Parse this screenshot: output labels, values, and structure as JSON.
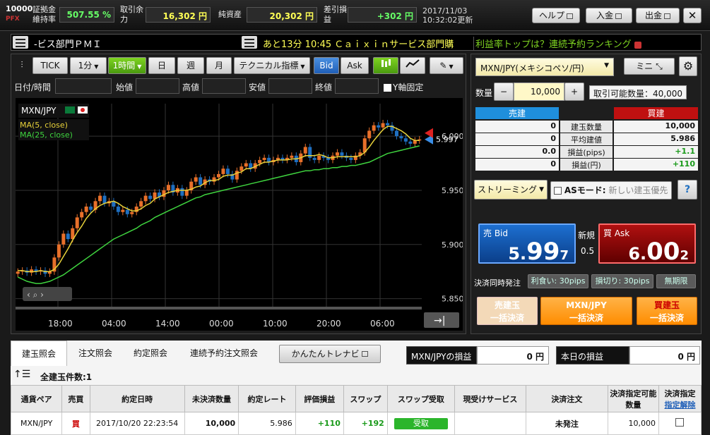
{
  "app": {
    "logo_top": "10000",
    "logo_bottom": "PFX"
  },
  "account": {
    "margin_label": "証拠金維持率",
    "margin_value": "507.55 %",
    "available_label": "取引余力",
    "available_value": "16,302 円",
    "assets_label": "純資産",
    "assets_value": "20,302 円",
    "pl_label": "差引損益",
    "pl_value": "+302 円",
    "date": "2017/11/03",
    "time": "10:32:02更新"
  },
  "top_buttons": {
    "help": "ヘルプ",
    "deposit": "入金",
    "withdraw": "出金",
    "close": "✕"
  },
  "news": {
    "left": "-ビス部門ＰＭＩ",
    "middle": "あと13分 10:45 Ｃａｉｘｉｎサービス部門購",
    "right": "利益率トップは？連続予約ランキング"
  },
  "chart_toolbar": {
    "tick": "TICK",
    "min": "1分",
    "hour": "1時間",
    "day": "日",
    "week": "週",
    "month": "月",
    "indicators": "テクニカル指標",
    "bid": "Bid",
    "ask": "Ask"
  },
  "ohlc": {
    "datetime": "日付/時間",
    "open": "始値",
    "high": "高値",
    "low": "安値",
    "close": "終値",
    "fix_y": "Y軸固定"
  },
  "chart_data": {
    "type": "candlestick",
    "symbol": "MXN/JPY",
    "legend": [
      "MA(5, close)",
      "MA(25, close)"
    ],
    "current_price": "5.997",
    "ylim": [
      5.84,
      6.03
    ],
    "yticks": [
      "6.000",
      "5.950",
      "5.900",
      "5.850"
    ],
    "xticks": [
      "18:00",
      "04:00",
      "14:00",
      "00:00",
      "10:00",
      "20:00",
      "06:00"
    ],
    "close": [
      5.875,
      5.876,
      5.874,
      5.877,
      5.875,
      5.876,
      5.873,
      5.875,
      5.888,
      5.9,
      5.91,
      5.905,
      5.915,
      5.925,
      5.93,
      5.935,
      5.932,
      5.94,
      5.945,
      5.938,
      5.94,
      5.935,
      5.93,
      5.932,
      5.928,
      5.93,
      5.935,
      5.94,
      5.945,
      5.942,
      5.948,
      5.944,
      5.95,
      5.955,
      5.948,
      5.952,
      5.945,
      5.95,
      5.958,
      5.962,
      5.955,
      5.96,
      5.958,
      5.962,
      5.965,
      5.97,
      5.965,
      5.96,
      5.968,
      5.972,
      5.975,
      5.97,
      5.975,
      5.978,
      5.98,
      5.976,
      5.978,
      5.98,
      5.978,
      5.98,
      5.982,
      5.976,
      5.984,
      5.99,
      5.98,
      5.978,
      5.982,
      5.98,
      5.978,
      5.982,
      5.985,
      5.982,
      5.98,
      5.978,
      5.982,
      5.985,
      5.998,
      6.005,
      6.01,
      6.008,
      6.012,
      6.01,
      6.005,
      6.0,
      5.998,
      5.995,
      5.993,
      5.996,
      5.997
    ],
    "ma5": [
      5.876,
      5.876,
      5.875,
      5.875,
      5.875,
      5.876,
      5.875,
      5.875,
      5.877,
      5.882,
      5.889,
      5.896,
      5.904,
      5.911,
      5.917,
      5.924,
      5.929,
      5.933,
      5.936,
      5.938,
      5.939,
      5.94,
      5.938,
      5.935,
      5.933,
      5.931,
      5.931,
      5.933,
      5.936,
      5.938,
      5.942,
      5.944,
      5.946,
      5.948,
      5.949,
      5.95,
      5.95,
      5.95,
      5.951,
      5.953,
      5.954,
      5.957,
      5.959,
      5.959,
      5.96,
      5.963,
      5.964,
      5.964,
      5.966,
      5.967,
      5.97,
      5.97,
      5.972,
      5.974,
      5.976,
      5.976,
      5.977,
      5.978,
      5.978,
      5.978,
      5.979,
      5.979,
      5.98,
      5.982,
      5.982,
      5.982,
      5.983,
      5.982,
      5.98,
      5.98,
      5.981,
      5.981,
      5.981,
      5.981,
      5.981,
      5.982,
      5.985,
      5.99,
      5.996,
      6.001,
      6.006,
      6.009,
      6.009,
      6.007,
      6.005,
      6.002,
      5.998,
      5.996,
      5.996
    ],
    "ma25": [
      5.87,
      5.868,
      5.866,
      5.865,
      5.864,
      5.864,
      5.865,
      5.866,
      5.868,
      5.87,
      5.872,
      5.875,
      5.878,
      5.881,
      5.884,
      5.887,
      5.89,
      5.893,
      5.896,
      5.899,
      5.902,
      5.905,
      5.907,
      5.909,
      5.911,
      5.913,
      5.915,
      5.918,
      5.92,
      5.922,
      5.925,
      5.927,
      5.929,
      5.931,
      5.933,
      5.935,
      5.937,
      5.939,
      5.941,
      5.943,
      5.944,
      5.946,
      5.947,
      5.948,
      5.949,
      5.95,
      5.951,
      5.952,
      5.953,
      5.954,
      5.955,
      5.956,
      5.957,
      5.958,
      5.959,
      5.96,
      5.961,
      5.962,
      5.963,
      5.964,
      5.965,
      5.966,
      5.967,
      5.968,
      5.968,
      5.969,
      5.969,
      5.97,
      5.97,
      5.971,
      5.971,
      5.972,
      5.972,
      5.973,
      5.973,
      5.974,
      5.975,
      5.976,
      5.978,
      5.98,
      5.982,
      5.984,
      5.985,
      5.986,
      5.987,
      5.988,
      5.989,
      5.99,
      5.991
    ]
  },
  "order": {
    "pair": "MXN/JPY(メキシコペソ/円)",
    "mini": "ミニ",
    "qty_label": "数量",
    "qty_value": "10,000",
    "minus": "−",
    "plus": "+",
    "available": "取引可能数量：40,000"
  },
  "positions": {
    "sell_header": "売建",
    "buy_header": "買建",
    "rows": [
      {
        "sell": "0",
        "label": "建玉数量",
        "buy": "10,000"
      },
      {
        "sell": "0",
        "label": "平均建値",
        "buy": "5.986"
      },
      {
        "sell": "0.0",
        "label": "損益(pips)",
        "buy": "+1.1"
      },
      {
        "sell": "0",
        "label": "損益(円)",
        "buy": "+110"
      }
    ]
  },
  "streaming": {
    "label": "ストリーミング",
    "as_mode": "ASモード:",
    "as_placeholder": "新しい建玉優先",
    "help": "?"
  },
  "quote": {
    "bid_label": "売 Bid",
    "bid_a": "5.",
    "bid_b": "99",
    "bid_c": "7",
    "spread_label": "新規",
    "spread": "0.5",
    "ask_label": "買 Ask",
    "ask_a": "6.",
    "ask_b": "00",
    "ask_c": "2"
  },
  "settle": {
    "label": "決済同時発注",
    "take_profit": "利食い: 30pips",
    "stop_loss": "損切り: 30pips",
    "unlimited": "無期限",
    "sell_all_1": "売建玉",
    "sell_all_2": "一括決済",
    "pair_all_1": "MXN/JPY",
    "pair_all_2": "一括決済",
    "buy_all_1": "買建玉",
    "buy_all_2": "一括決済"
  },
  "bottom": {
    "tabs": [
      "建玉照会",
      "注文照会",
      "約定照会",
      "連続予約注文照会"
    ],
    "navi": "かんたんトレナビ",
    "pair_pl_label": "MXN/JPYの損益",
    "pair_pl_value": "0 円",
    "today_pl_label": "本日の損益",
    "today_pl_value": "0 円",
    "count_label": "全建玉件数:1",
    "headers": [
      "通貨ペア",
      "売買",
      "約定日時",
      "未決済数量",
      "約定レート",
      "評価損益",
      "スワップ",
      "スワップ受取",
      "現受けサービス",
      "決済注文",
      "決済指定可能数量",
      "決済指定"
    ],
    "clear": "指定解除",
    "row": {
      "pair": "MXN/JPY",
      "side": "買",
      "datetime": "2017/10/20 22:23:54",
      "qty": "10,000",
      "rate": "5.986",
      "pl": "+110",
      "swap": "+192",
      "swap_recv": "受取",
      "service": "",
      "order": "未発注",
      "avail_qty": "10,000"
    }
  },
  "colors": {
    "green": "#7ed321",
    "red": "#c01010",
    "blue": "#1f8fdc",
    "candle_up": "#e8702a",
    "candle_down": "#1f6fc0"
  }
}
